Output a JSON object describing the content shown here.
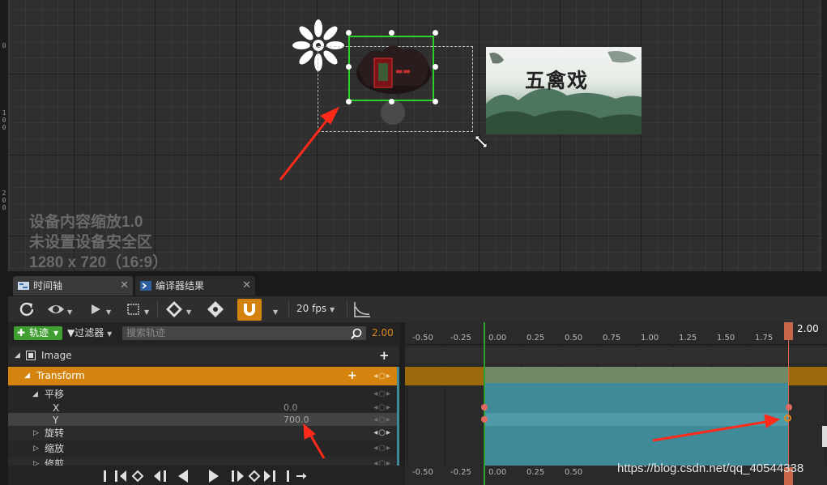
{
  "viewport": {
    "ruler_labels": [
      "0",
      "100",
      "200"
    ],
    "info": {
      "dpi_scale": "设备内容缩放1.0",
      "safe_zone": "未设置设备安全区",
      "resolution": "1280 x 720（16:9）"
    },
    "bg_image_title": "五禽戏"
  },
  "tabs": [
    {
      "label": "时间轴",
      "close": "✕"
    },
    {
      "label": "编译器结果",
      "close": "✕"
    }
  ],
  "toolbar": {
    "fps": "20 fps"
  },
  "track_bar": {
    "add_track_label": "轨迹",
    "filter_label": "过滤器",
    "search_placeholder": "搜索轨迹",
    "current_time": "2.00"
  },
  "tracks": {
    "image": "Image",
    "transform": "Transform",
    "translation": "平移",
    "x_label": "X",
    "x_value": "0.0",
    "y_label": "Y",
    "y_value": "700.0",
    "rotation": "旋转",
    "scale": "缩放",
    "shear": "修剪"
  },
  "timeline": {
    "ticks": [
      "-0.50",
      "-0.25",
      "0.00",
      "0.25",
      "0.50",
      "0.75",
      "1.00",
      "1.25",
      "1.50",
      "1.75"
    ],
    "playhead_label": "2.00"
  },
  "watermark": "https://blog.csdn.net/qq_40544338",
  "colors": {
    "accent_orange": "#d4830e",
    "section_teal": "#3e8a99",
    "selection_green": "#2cd02c",
    "playhead_red": "#c8664a",
    "add_green": "#3f9f30"
  }
}
